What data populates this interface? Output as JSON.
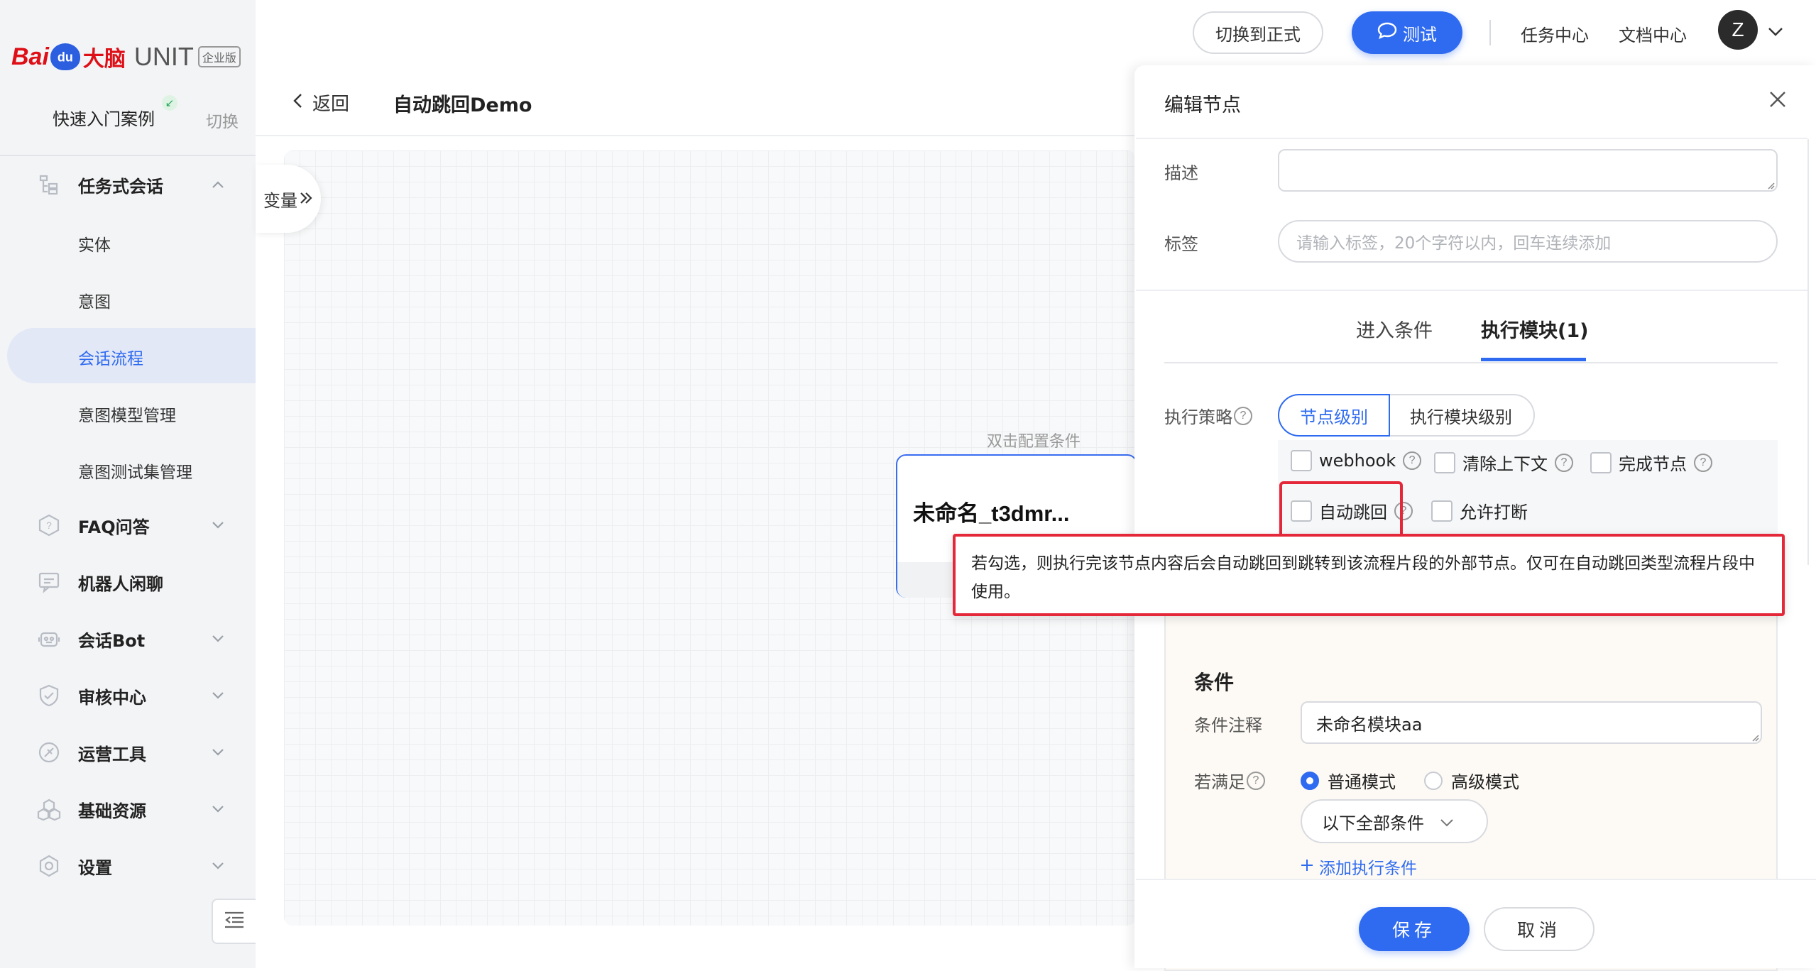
{
  "brand": {
    "logo_text": "Bai",
    "logo_paw": "du",
    "logo_brain": "大脑",
    "product": "UNIT",
    "edition": "企业版"
  },
  "sidebar": {
    "case_title": "快速入门案例",
    "switch_label": "切换",
    "items": [
      {
        "label": "任务式会话",
        "icon": "tree-icon",
        "expanded": true
      },
      {
        "label": "实体"
      },
      {
        "label": "意图"
      },
      {
        "label": "会话流程",
        "active": true
      },
      {
        "label": "意图模型管理"
      },
      {
        "label": "意图测试集管理"
      },
      {
        "label": "FAQ问答",
        "icon": "question-shield-icon"
      },
      {
        "label": "机器人闲聊",
        "icon": "chat-icon"
      },
      {
        "label": "会话Bot",
        "icon": "robot-icon"
      },
      {
        "label": "审核中心",
        "icon": "shield-check-icon"
      },
      {
        "label": "运营工具",
        "icon": "tool-icon"
      },
      {
        "label": "基础资源",
        "icon": "cubes-icon"
      },
      {
        "label": "设置",
        "icon": "hex-gear-icon"
      }
    ]
  },
  "topnav": {
    "switch_formal": "切换到正式",
    "test": "测试",
    "task_center": "任务中心",
    "doc_center": "文档中心",
    "avatar_letter": "Z"
  },
  "page": {
    "back": "返回",
    "title": "自动跳回Demo"
  },
  "canvas": {
    "variables_tab": "变量",
    "node_hint": "双击配置条件",
    "node_name": "未命名_t3dmr..."
  },
  "panel": {
    "title": "编辑节点",
    "description_label": "描述",
    "description_value": "",
    "tags_label": "标签",
    "tags_placeholder": "请输入标签，20个字符以内，回车连续添加",
    "tabs": [
      {
        "label": "进入条件",
        "active": false
      },
      {
        "label": "执行模块(1)",
        "active": true
      }
    ],
    "strategy_label": "执行策略",
    "strategy_options": [
      {
        "label": "节点级别",
        "selected": true
      },
      {
        "label": "执行模块级别",
        "selected": false
      }
    ],
    "checkboxes": [
      {
        "label": "webhook",
        "checked": false
      },
      {
        "label": "清除上下文",
        "checked": false
      },
      {
        "label": "完成节点",
        "checked": false
      },
      {
        "label": "自动跳回",
        "checked": false
      },
      {
        "label": "允许打断",
        "checked": false
      }
    ],
    "tooltip": "若勾选，则执行完该节点内容后会自动跳回到跳转到该流程片段的外部节点。仅可在自动跳回类型流程片段中使用。",
    "module": {
      "title": "条件",
      "note_label": "条件注释",
      "note_value": "未命名模块aa",
      "match_label": "若满足",
      "modes": [
        {
          "label": "普通模式",
          "selected": true
        },
        {
          "label": "高级模式",
          "selected": false
        }
      ],
      "condition_select": "以下全部条件",
      "add_condition": "添加执行条件"
    },
    "save": "保存",
    "cancel": "取消"
  },
  "colors": {
    "primary": "#2f6bf0",
    "highlight": "#e4283a",
    "brand_red": "#de0f17"
  }
}
